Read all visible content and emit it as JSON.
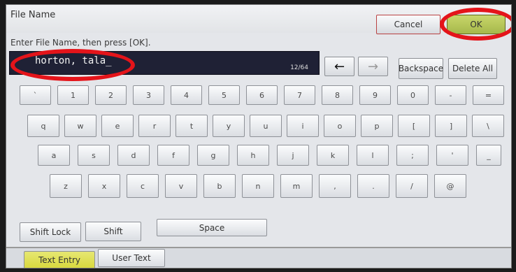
{
  "window": {
    "title": "File Name",
    "cancel_label": "Cancel",
    "ok_label": "OK"
  },
  "instruction": "Enter File Name, then press [OK].",
  "entry": {
    "value": "horton, tala_",
    "counter": "12/64"
  },
  "controls": {
    "left_arrow": "←",
    "right_arrow": "→",
    "backspace_label": "Backspace",
    "delete_all_label": "Delete All"
  },
  "keyboard": {
    "row1": [
      "`",
      "1",
      "2",
      "3",
      "4",
      "5",
      "6",
      "7",
      "8",
      "9",
      "0",
      "-",
      "="
    ],
    "row2": [
      "q",
      "w",
      "e",
      "r",
      "t",
      "y",
      "u",
      "i",
      "o",
      "p",
      "[",
      "]",
      "\\"
    ],
    "row3": [
      "a",
      "s",
      "d",
      "f",
      "g",
      "h",
      "j",
      "k",
      "l",
      ";",
      "'",
      "_"
    ],
    "row4": [
      "z",
      "x",
      "c",
      "v",
      "b",
      "n",
      "m",
      ",",
      ".",
      "/",
      "@"
    ]
  },
  "bottom": {
    "shift_lock_label": "Shift Lock",
    "shift_label": "Shift",
    "space_label": "Space"
  },
  "tabs": [
    "Text Entry",
    "User Text"
  ],
  "colors": {
    "annotation_red": "#e4141a",
    "ok_green": "#a6b84b",
    "active_tab_yellow": "#e6e772",
    "entry_bg": "#1f2135"
  }
}
